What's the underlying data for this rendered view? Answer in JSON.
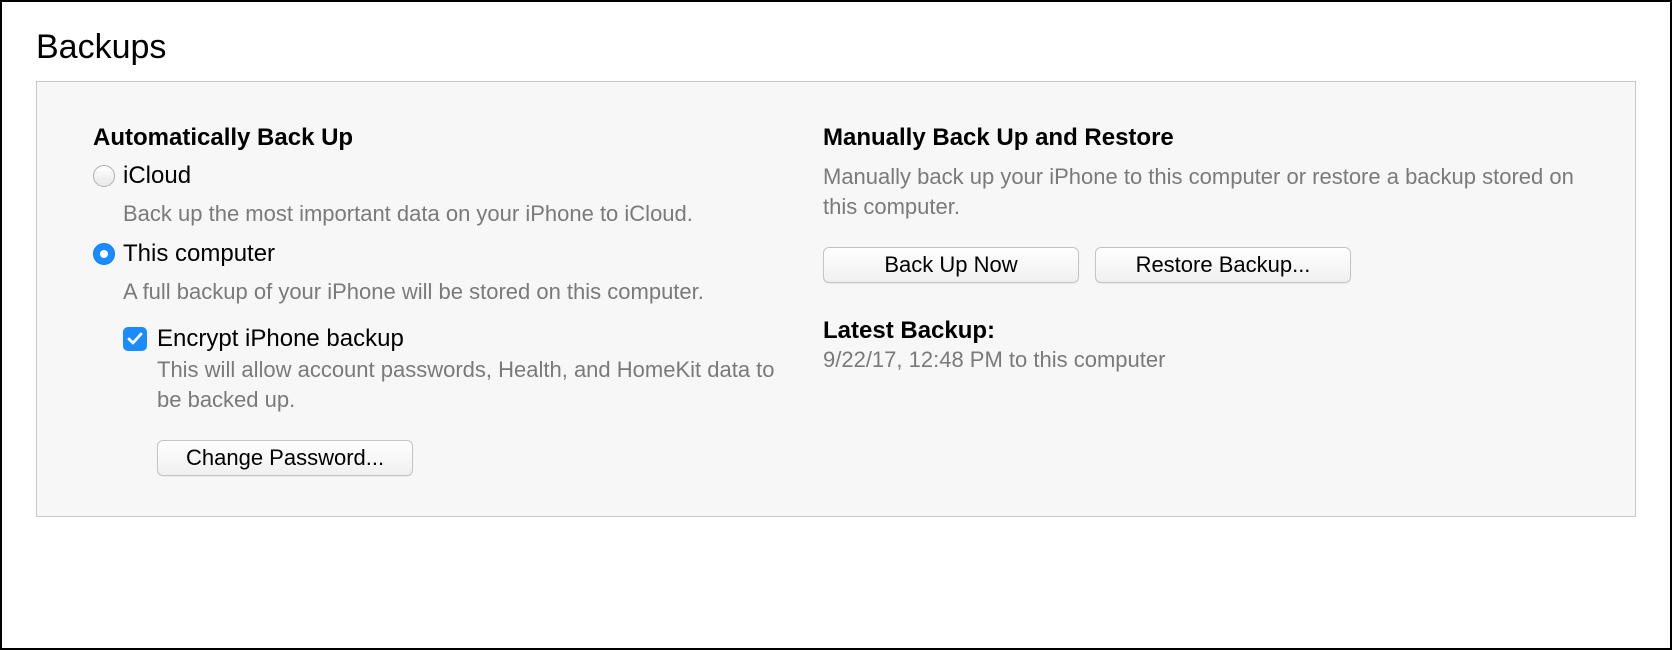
{
  "section": {
    "title": "Backups"
  },
  "auto": {
    "heading": "Automatically Back Up",
    "icloud": {
      "label": "iCloud",
      "desc": "Back up the most important data on your iPhone to iCloud."
    },
    "computer": {
      "label": "This computer",
      "desc": "A full backup of your iPhone will be stored on this computer."
    },
    "encrypt": {
      "label": "Encrypt iPhone backup",
      "desc": "This will allow account passwords, Health, and HomeKit data to be backed up."
    },
    "change_password_btn": "Change Password..."
  },
  "manual": {
    "heading": "Manually Back Up and Restore",
    "desc": "Manually back up your iPhone to this computer or restore a backup stored on this computer.",
    "backup_now_btn": "Back Up Now",
    "restore_btn": "Restore Backup..."
  },
  "latest": {
    "heading": "Latest Backup:",
    "value": "9/22/17, 12:48 PM to this computer"
  }
}
